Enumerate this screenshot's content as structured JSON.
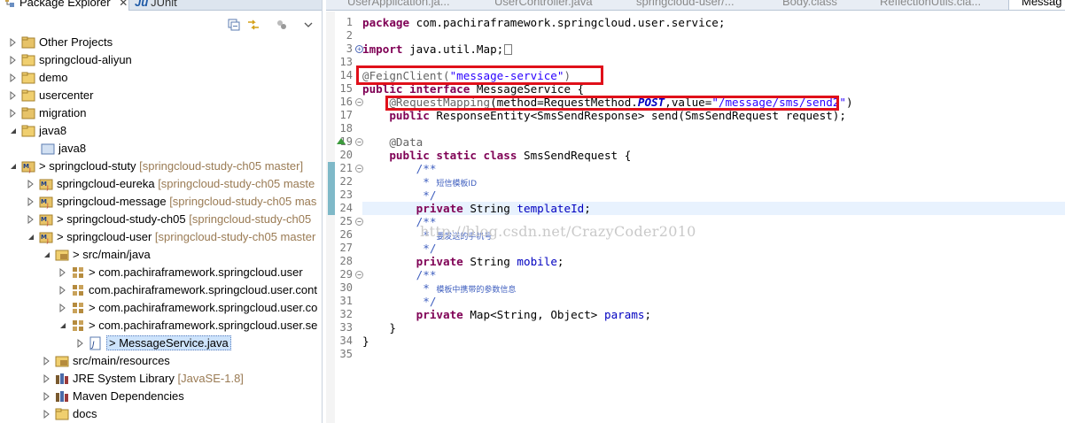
{
  "explorer": {
    "tab_package_explorer": "Package Explorer",
    "tab_close": "✕",
    "tab_junit": "JUnit",
    "junit_prefix": "Ju",
    "tree": [
      {
        "label": "Other Projects",
        "extra": "",
        "prefix": ""
      },
      {
        "label": "springcloud-aliyun",
        "extra": "",
        "prefix": ""
      },
      {
        "label": "demo",
        "extra": "",
        "prefix": ""
      },
      {
        "label": "usercenter",
        "extra": "",
        "prefix": ""
      },
      {
        "label": "migration",
        "extra": "",
        "prefix": ""
      },
      {
        "label": "java8",
        "extra": "",
        "prefix": ""
      },
      {
        "label": "java8",
        "extra": "",
        "prefix": ""
      },
      {
        "label": "springcloud-stuty",
        "extra": "[springcloud-study-ch05 master]",
        "prefix": "> "
      },
      {
        "label": "springcloud-eureka",
        "extra": "[springcloud-study-ch05 maste",
        "prefix": ""
      },
      {
        "label": "springcloud-message",
        "extra": "[springcloud-study-ch05 mas",
        "prefix": ""
      },
      {
        "label": "springcloud-study-ch05",
        "extra": "[springcloud-study-ch05",
        "prefix": "> "
      },
      {
        "label": "springcloud-user",
        "extra": "[springcloud-study-ch05 master",
        "prefix": "> "
      },
      {
        "label": "src/main/java",
        "extra": "",
        "prefix": "> "
      },
      {
        "label": "com.pachiraframework.springcloud.user",
        "extra": "",
        "prefix": "> "
      },
      {
        "label": "com.pachiraframework.springcloud.user.cont",
        "extra": "",
        "prefix": ""
      },
      {
        "label": "com.pachiraframework.springcloud.user.co",
        "extra": "",
        "prefix": "> "
      },
      {
        "label": "com.pachiraframework.springcloud.user.se",
        "extra": "",
        "prefix": "> "
      },
      {
        "label": "MessageService.java",
        "extra": "",
        "prefix": "> "
      },
      {
        "label": "src/main/resources",
        "extra": "",
        "prefix": ""
      },
      {
        "label": "JRE System Library",
        "extra": "[JavaSE-1.8]",
        "prefix": ""
      },
      {
        "label": "Maven Dependencies",
        "extra": "",
        "prefix": ""
      },
      {
        "label": "docs",
        "extra": "",
        "prefix": ""
      }
    ]
  },
  "editor": {
    "tabs": [
      {
        "label": "UserApplication.ja..."
      },
      {
        "label": "UserController.java"
      },
      {
        "label": "springcloud-user/..."
      },
      {
        "label": "Body.class"
      },
      {
        "label": "ReflectionUtils.cla..."
      },
      {
        "label": "Messag"
      }
    ],
    "line_numbers": [
      "1",
      "2",
      "3",
      "13",
      "14",
      "15",
      "16",
      "17",
      "18",
      "19",
      "20",
      "21",
      "22",
      "23",
      "24",
      "25",
      "26",
      "27",
      "28",
      "29",
      "30",
      "31",
      "32",
      "33",
      "34",
      "35"
    ],
    "code": {
      "l1_kw": "package",
      "l1_rest": " com.pachiraframework.springcloud.user.service;",
      "l3_kw": "import",
      "l3_rest": " java.util.Map;",
      "l14_ann": "@FeignClient(",
      "l14_str": "\"message-service\"",
      "l14_end": ")",
      "l15_kw": "public interface",
      "l15_rest": " MessageService {",
      "l16_ann": "@RequestMapping",
      "l16_a": "(method=RequestMethod.",
      "l16_enum": "POST",
      "l16_b": ",value=",
      "l16_str": "\"/message/sms/send2\"",
      "l16_end": ")",
      "l17_kw": "public",
      "l17_rest": " ResponseEntity<SmsSendResponse> send(SmsSendRequest request);",
      "l19_ann": "@Data",
      "l20_kw": "public static class",
      "l20_rest": " SmsSendRequest {",
      "c_open": "/**",
      "c_star": " * ",
      "c_close": " */",
      "c22_text": "短信模板ID",
      "c26_text": "要发送的手机号",
      "c30_text": "模板中携带的参数信息",
      "f_kw": "private",
      "f24_type": " String ",
      "f24_name": "templateId",
      "f28_type": " String ",
      "f28_name": "mobile",
      "f32_type": " Map<String, Object> ",
      "f32_name": "params",
      "semi": ";",
      "brace_close": "}"
    },
    "watermark": "http://blog.csdn.net/CrazyCoder2010"
  },
  "colors": {
    "highlight_box": "#e0101a",
    "keyword": "#7f0055",
    "string": "#2a00ff",
    "comment": "#3f5fbf",
    "field": "#0000c0"
  }
}
